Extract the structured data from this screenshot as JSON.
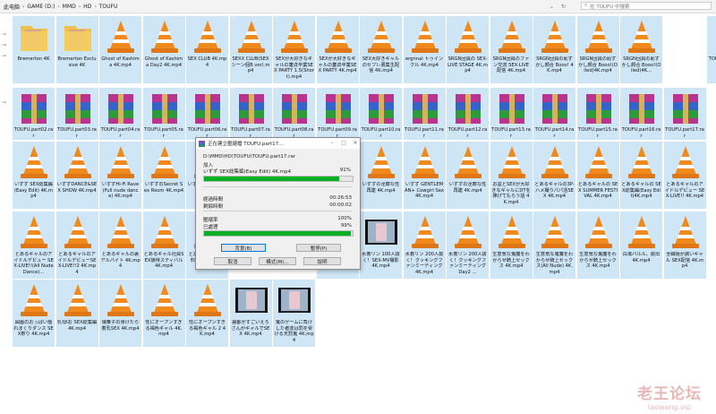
{
  "breadcrumb": [
    "此电脑",
    "GAME (D:)",
    "MMD",
    "HD",
    "TOUFU"
  ],
  "search": {
    "placeholder": "在 TOUFU 中搜索"
  },
  "rows": [
    [
      "Bremerton 4K",
      "Bremerton Exclusive 4K",
      "Ghost of Kashima 4K.mp4",
      "Ghost of Kashima Day2 4K.mp4",
      "SEX CLUB 4K.mp4",
      "SEXX CLUB(SEXシーン個B ver).mp4",
      "SEXが大好きなギャルの童貞卒業SEX PARTY 1.5(Short).mp4",
      "SEXが大好きなギャルの童貞卒業SEX PARTY 4K.mp4",
      "SEX大好きギャルのセフレ募集生配信 4K.mp4",
      "ergnnal トゥインクル 4K.mp4",
      "SRGN団員の SEX-LIVE STAGE 4K.mp4",
      "SRGN団員のファン交流 SEX-LIVE配信 4K.mp4",
      "SRGN団員の恥ずかし顔合 Booo! 4K.mp4",
      "SRGN団員の恥ずかし顔合 Booo!(Oiled)4K.mp4",
      "SRGN団員の恥ずかし顔合 Booo!(Oiled)4K...",
      "",
      "TOUFU.part01.rar"
    ],
    [
      "TOUFU.part02.rar",
      "TOUFU.part03.rar",
      "TOUFU.part04.rar",
      "TOUFU.part05.rar",
      "TOUFU.part06.rar",
      "TOUFU.part07.rar",
      "TOUFU.part08.rar",
      "TOUFU.part09.rar",
      "TOUFU.part10.rar",
      "TOUFU.part11.rar",
      "TOUFU.part12.rar",
      "TOUFU.part13.rar",
      "TOUFU.part14.rar",
      "TOUFU.part15.rar",
      "TOUFU.part16.rar",
      "TOUFU.part17.rar"
    ],
    [
      "いずず SEX総集編(Easy Edit) 4K.mp4",
      "いずずDANCE&SEX SHOW 4K.mp4",
      "いずずHi-Fi Rave(Full nude dance) 4K.mp4",
      "いずずのSecret Sex Room 4K.mp4",
      "いずずのムフフ H-ERO...",
      "",
      "",
      "",
      "いずずの淫靡な性再建 4K.mp4",
      "いずず GENTLEMAN+ Cowgirl Sex 4K.mp4",
      "いずずの淫靡な性再建 4K.mp4",
      "お盆とSEXが大好きなギャルにDTを捧げてもらう話 4K.mp4",
      "とあるギャルの3P-ハメ撮りパパ活SEX 4K.mp4",
      "とあるギャルの SEX SUMMER FESTIVAL 4K.mp4",
      "とあるギャルの SEX総集編(Easy Edit)4K.mp4",
      "とあるギャルのアイドルデビュー SEX-LIVE!! 4K.mp4"
    ],
    [
      "とあるギャルのアイドルデビュー SEX-LIVE!!(All Nude Dance)...",
      "とあるギャルのアイドルデビューSEX-LIVE!!2 4K.mp4",
      "とあるギャルの裏アルバイト 4K.mp4",
      "とあるギャル社員SEX接待スティバル 4K.mp4",
      "とあるギャルの有料立ち 4K.mp4",
      "",
      "",
      "メンヘラじゃないもん 退廃ファン full nude 4K.mp4",
      "水着リン 100人抜く！SEX-MV撮影 4K.mp4",
      "水着リン 200人抜く！クッキングファンミーティング 4K.mp4",
      "水着リン 200人抜く！クッキングファンミーティング Day2 ...",
      "生意気な鬼魔をわからせ騎上セックス 4K.mp4",
      "生意気な鬼魔をわからせ騎上セックス(All Nude) 4K.mp4",
      "生意気な鬼魔をわからせ騎上セックス 4K.mp4",
      "白濁バルル、脱出 4K.mp4",
      "全職姫が誘いギャル SEX配信 4K.mp4"
    ],
    [
      "図画のおっぱい揺れまくりダンス SEX祭り 4K.mp4",
      "乳母Iお SEX総集編4K.mp4",
      "娘乗子の身けたら着乳SEX 4K.mp4",
      "性にオープンすぎる褐色ギャル 4K.mp4",
      "性にオープンすぎる褐色ギャル 2 4K.mp4",
      "麗都がすごいえろさんがギャルでSEX 4K.mp4",
      "鬼のゲームに負けした者達は罰を受ける天罰鬼 4K.mp4"
    ]
  ],
  "dialog": {
    "title": "正在建立壓縮檔 TOUFU.part17...",
    "path": "D:\\MMD\\HD\\TOUFU\\TOUFU.part17.rar",
    "adding_label": "加入",
    "file_name": "いずず SEX総集編(Easy Edit) 4K.mp4",
    "file_percent": "91%",
    "file_progress": 0.91,
    "elapsed_label": "經過時間",
    "elapsed_value": "00:26:53",
    "remaining_label": "剩餘時間",
    "remaining_value": "00:00:02",
    "ratio_label": "壓縮率",
    "ratio_value": "100%",
    "processed_label": "已處理",
    "processed_value": "99%",
    "total_progress": 0.99,
    "background_button": "背景(B)",
    "pause_button": "暫停(P)",
    "cancel_button": "取消",
    "mode_button": "模式(M)...",
    "help_button": "說明"
  },
  "watermark": {
    "chinese": "老王论坛",
    "url": "laowang.vip"
  },
  "colors": {
    "tile_selected": "#cfe6f7",
    "progress": "#06b025",
    "vlc_orange": "#f08a1d"
  }
}
